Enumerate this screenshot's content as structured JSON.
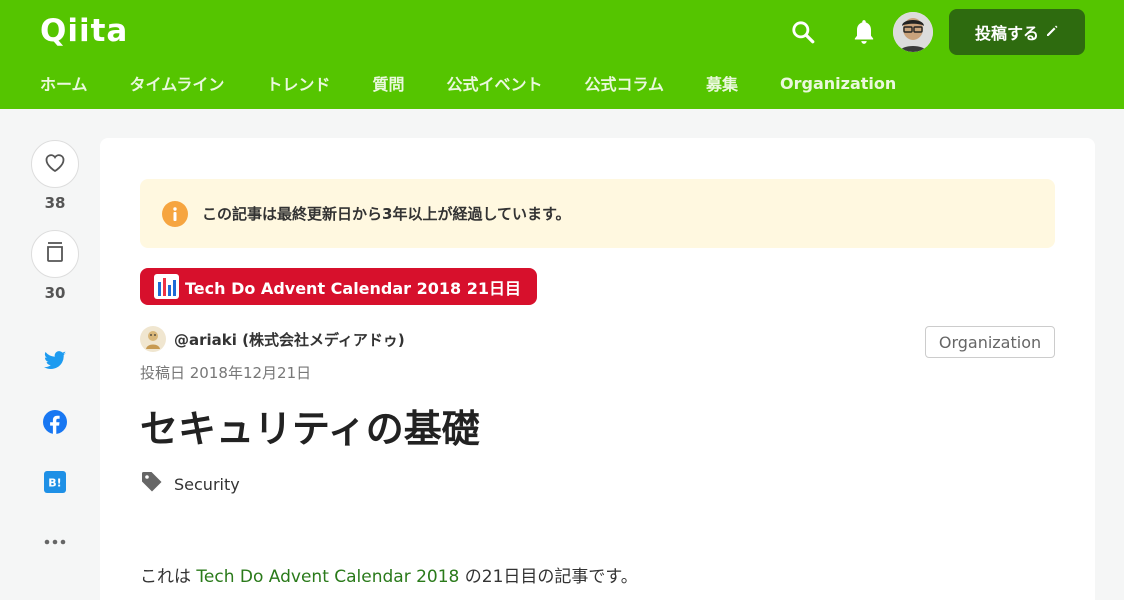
{
  "header": {
    "logo": "Qiita",
    "post_button": "投稿する",
    "nav": [
      "ホーム",
      "タイムライン",
      "トレンド",
      "質問",
      "公式イベント",
      "公式コラム",
      "募集",
      "Organization"
    ]
  },
  "sidebar": {
    "like_count": "38",
    "stock_count": "30"
  },
  "article": {
    "notice": "この記事は最終更新日から3年以上が経過しています。",
    "advent_badge": "Tech Do Advent Calendar 2018 21日目",
    "author": "@ariaki (株式会社メディアドゥ)",
    "org_button": "Organization",
    "post_date": "投稿日 2018年12月21日",
    "title": "セキュリティの基礎",
    "tag": "Security",
    "body": {
      "prefix": "これは ",
      "link": "Tech Do Advent Calendar 2018",
      "suffix": " の21日目の記事です。"
    }
  },
  "colors": {
    "brand": "#55c500",
    "post_button": "#2e6b0f",
    "advent": "#d7102c",
    "notice_bg": "#fff8e0",
    "link": "#2a7a1a"
  }
}
